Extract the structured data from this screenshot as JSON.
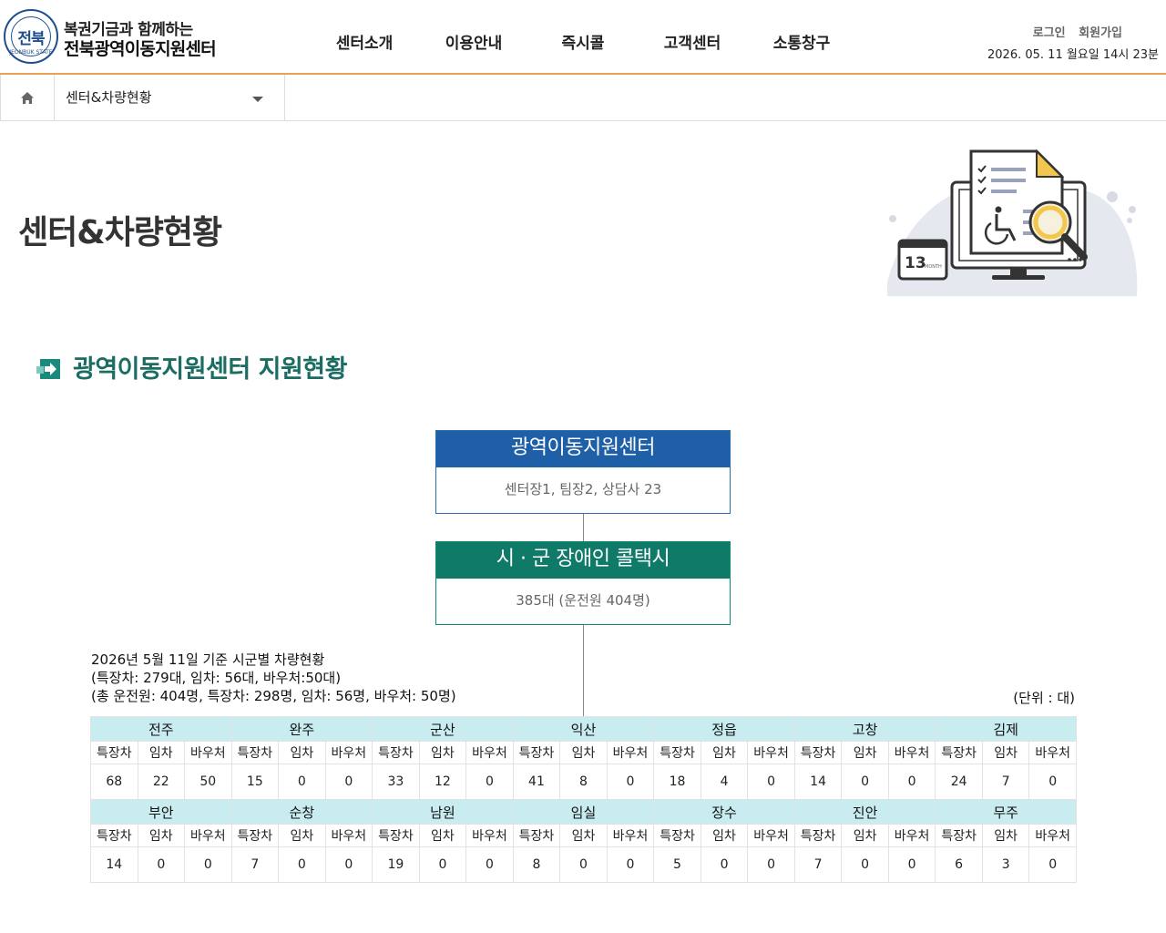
{
  "header": {
    "logo_badge": "전북",
    "logo_ring": "JEONBUK STATE",
    "logo_line1": "복권기금과 함께하는",
    "logo_line2": "전북광역이동지원센터",
    "nav": [
      "센터소개",
      "이용안내",
      "즉시콜",
      "고객센터",
      "소통창구"
    ],
    "login": "로그인",
    "signup": "회원가입",
    "datetime": "2026. 05. 11 월요일 14시 23분"
  },
  "breadcrumb": {
    "current": "센터&차량현황"
  },
  "page_title": "센터&차량현황",
  "hero": {
    "calendar_day": "13",
    "calendar_month": "MONTH"
  },
  "section_title": "광역이동지원센터 지원현황",
  "org": {
    "top_title": "광역이동지원센터",
    "top_desc": "센터장1, 팀장2, 상담사 23",
    "bottom_title": "시 · 군 장애인 콜택시",
    "bottom_desc": "385대 (운전원 404명)"
  },
  "summary": {
    "line1": "2026년 5월 11일 기준 시군별 차량현황",
    "line2": "(특장차: 279대, 임차: 56대, 바우처:50대)",
    "line3": "(총 운전원: 404명, 특장차: 298명, 임차: 56명, 바우처: 50명)",
    "unit": "(단위 : 대)"
  },
  "table": {
    "sub_headers": [
      "특장차",
      "임차",
      "바우처"
    ],
    "rows": [
      [
        {
          "region": "전주",
          "values": [
            "68",
            "22",
            "50"
          ]
        },
        {
          "region": "완주",
          "values": [
            "15",
            "0",
            "0"
          ]
        },
        {
          "region": "군산",
          "values": [
            "33",
            "12",
            "0"
          ]
        },
        {
          "region": "익산",
          "values": [
            "41",
            "8",
            "0"
          ]
        },
        {
          "region": "정읍",
          "values": [
            "18",
            "4",
            "0"
          ]
        },
        {
          "region": "고창",
          "values": [
            "14",
            "0",
            "0"
          ]
        },
        {
          "region": "김제",
          "values": [
            "24",
            "7",
            "0"
          ]
        }
      ],
      [
        {
          "region": "부안",
          "values": [
            "14",
            "0",
            "0"
          ]
        },
        {
          "region": "순창",
          "values": [
            "7",
            "0",
            "0"
          ]
        },
        {
          "region": "남원",
          "values": [
            "19",
            "0",
            "0"
          ]
        },
        {
          "region": "임실",
          "values": [
            "8",
            "0",
            "0"
          ]
        },
        {
          "region": "장수",
          "values": [
            "5",
            "0",
            "0"
          ]
        },
        {
          "region": "진안",
          "values": [
            "7",
            "0",
            "0"
          ]
        },
        {
          "region": "무주",
          "values": [
            "6",
            "3",
            "0"
          ]
        }
      ]
    ]
  },
  "colors": {
    "accent_orange": "#e9a15a",
    "blue_header": "#1f5fa8",
    "green_header": "#107a68",
    "section_title": "#1b6c63",
    "table_region_bg": "#c8ecef"
  }
}
